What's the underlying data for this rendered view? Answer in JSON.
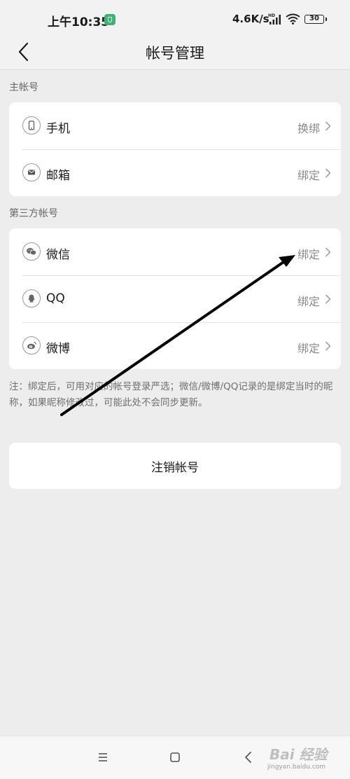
{
  "status_bar": {
    "time": "上午10:35",
    "network_speed": "4.6K/s",
    "signal_label": "HD",
    "battery": "30"
  },
  "nav": {
    "title": "帐号管理"
  },
  "main_account": {
    "section_label": "主帐号",
    "rows": [
      {
        "icon": "phone-icon",
        "label": "手机",
        "action": "换绑"
      },
      {
        "icon": "mail-icon",
        "label": "邮箱",
        "action": "绑定"
      }
    ]
  },
  "third_party": {
    "section_label": "第三方帐号",
    "rows": [
      {
        "icon": "wechat-icon",
        "label": "微信",
        "action": "绑定"
      },
      {
        "icon": "qq-icon",
        "label": "QQ",
        "action": "绑定"
      },
      {
        "icon": "weibo-icon",
        "label": "微博",
        "action": "绑定"
      }
    ]
  },
  "note": "注：绑定后，可用对应的帐号登录严选；微信/微博/QQ记录的是绑定当时的昵称，如果昵称修改过，可能此处不会同步更新。",
  "logout_label": "注销帐号",
  "watermark": {
    "text": "Bai 经验",
    "url": "jingyan.baidu.com"
  },
  "colors": {
    "background": "#ededed",
    "card": "#ffffff",
    "muted_text": "#8a8a8a",
    "app_badge": "#3cb371"
  }
}
